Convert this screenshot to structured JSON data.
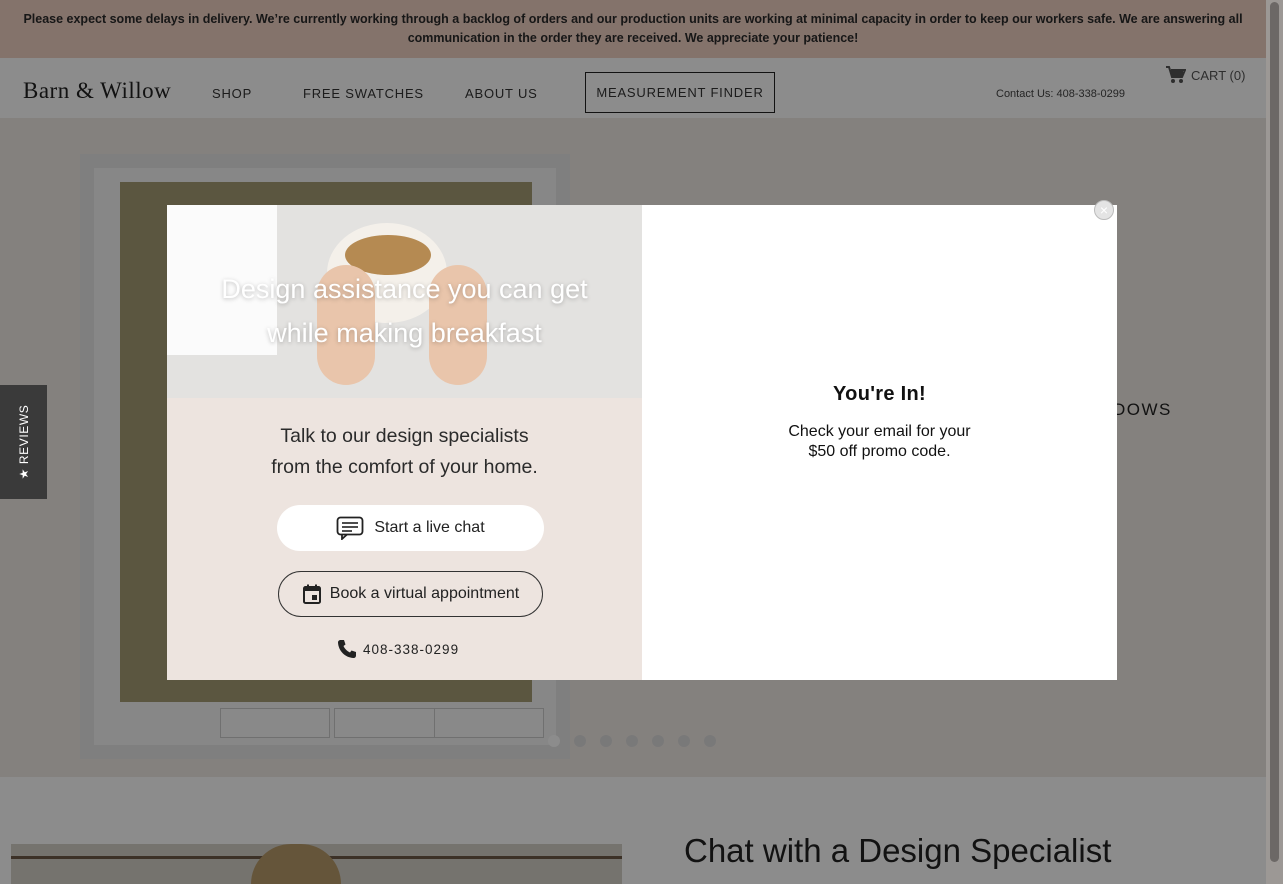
{
  "banner": {
    "text": "Please expect some delays in delivery. We’re currently working through a backlog of orders and our production units are working at minimal capacity in order to keep our workers safe. We are answering all communication in the order they are received. We appreciate your patience!"
  },
  "header": {
    "logo": "Barn & Willow",
    "nav": {
      "shop": "SHOP",
      "swatches": "FREE SWATCHES",
      "about": "ABOUT US",
      "measurement": "MEASUREMENT FINDER"
    },
    "contact": "Contact Us: 408-338-0299",
    "cart_label": "CART (0)",
    "cart_icon": "cart-icon"
  },
  "hero": {
    "partial_text": "DOWS",
    "slides": 7,
    "active_slide": 1
  },
  "section2": {
    "heading": "Chat with a Design Specialist"
  },
  "reviews_tab": {
    "label": "★ REVIEWS"
  },
  "modal": {
    "photo_title_line1": "Design assistance you can get",
    "photo_title_line2": "while making breakfast",
    "talk_line1": "Talk to our design specialists",
    "talk_line2": "from the comfort of your home.",
    "chat_button": "Start a live chat",
    "book_button": "Book a virtual appointment",
    "phone": "408-338-0299",
    "confirm_title": "You're In!",
    "confirm_line1": "Check your email for your",
    "confirm_line2": "$50 off promo code.",
    "close_symbol": "×"
  },
  "colors": {
    "banner_bg": "#f1d1c4",
    "modal_left_bg": "#ede4df",
    "overlay": "rgba(0,0,0,0.45)"
  }
}
